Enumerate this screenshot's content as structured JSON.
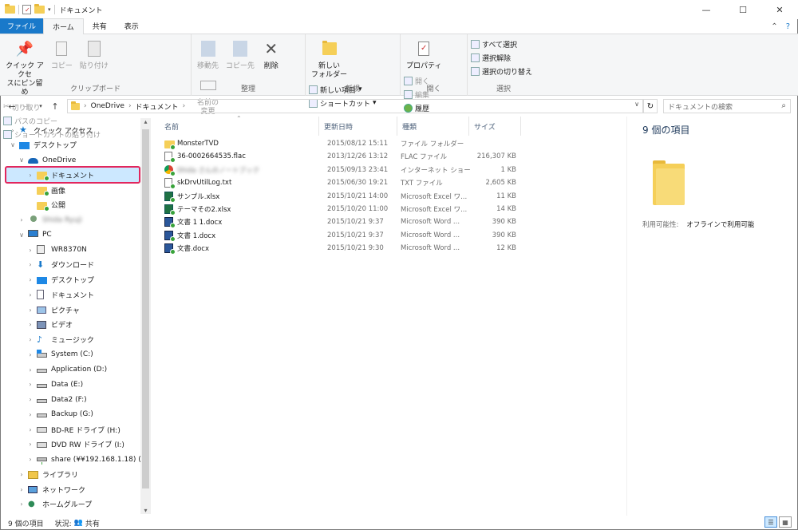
{
  "window": {
    "title": "ドキュメント",
    "controls": [
      "minimize",
      "maximize",
      "close"
    ]
  },
  "ribbon_tabs": [
    "ファイル",
    "ホーム",
    "共有",
    "表示"
  ],
  "ribbon": {
    "clipboard": {
      "label": "クリップボード",
      "pin_line1": "クイック アクセ",
      "pin_line2": "スにピン留め",
      "copy": "コピー",
      "paste": "貼り付け",
      "cut": "切り取り",
      "copy_path": "パスのコピー",
      "paste_shortcut": "ショートカットの貼り付け"
    },
    "organize": {
      "label": "整理",
      "move_to": "移動先",
      "copy_to": "コピー先",
      "delete": "削除",
      "rename_line1": "名前の",
      "rename_line2": "変更"
    },
    "new": {
      "label": "新規",
      "new_folder_line1": "新しい",
      "new_folder_line2": "フォルダー",
      "new_item": "新しい項目",
      "shortcut": "ショートカット"
    },
    "open": {
      "label": "開く",
      "properties": "プロパティ",
      "open": "開く",
      "edit": "編集",
      "history": "履歴"
    },
    "select": {
      "label": "選択",
      "select_all": "すべて選択",
      "select_none": "選択解除",
      "invert": "選択の切り替え"
    }
  },
  "address": {
    "path": [
      "OneDrive",
      "ドキュメント"
    ],
    "search_placeholder": "ドキュメントの検索"
  },
  "nav": [
    {
      "label": "クイック アクセス",
      "icon": "star-icon",
      "indent": 0,
      "expander": "collapsed"
    },
    {
      "label": "デスクトップ",
      "icon": "desktop-icon",
      "indent": 0,
      "expander": "expanded"
    },
    {
      "label": "OneDrive",
      "icon": "cloud-icon",
      "indent": 1,
      "expander": "expanded"
    },
    {
      "label": "ドキュメント",
      "icon": "folder-icon",
      "indent": 2,
      "expander": "collapsed",
      "selected": true
    },
    {
      "label": "画像",
      "icon": "folder-icon",
      "indent": 2,
      "expander": "none"
    },
    {
      "label": "公開",
      "icon": "folder-icon",
      "indent": 2,
      "expander": "none"
    },
    {
      "label": "Shida Ryuji",
      "icon": "user-icon",
      "indent": 1,
      "expander": "collapsed",
      "blurred": true
    },
    {
      "label": "PC",
      "icon": "pc-icon",
      "indent": 1,
      "expander": "expanded"
    },
    {
      "label": "WR8370N",
      "icon": "router-icon",
      "indent": 2,
      "expander": "collapsed"
    },
    {
      "label": "ダウンロード",
      "icon": "download-icon",
      "indent": 2,
      "expander": "collapsed"
    },
    {
      "label": "デスクトップ",
      "icon": "desktop-icon",
      "indent": 2,
      "expander": "collapsed"
    },
    {
      "label": "ドキュメント",
      "icon": "document-icon",
      "indent": 2,
      "expander": "collapsed"
    },
    {
      "label": "ピクチャ",
      "icon": "pictures-icon",
      "indent": 2,
      "expander": "collapsed"
    },
    {
      "label": "ビデオ",
      "icon": "video-icon",
      "indent": 2,
      "expander": "collapsed"
    },
    {
      "label": "ミュージック",
      "icon": "music-icon",
      "indent": 2,
      "expander": "collapsed"
    },
    {
      "label": "System (C:)",
      "icon": "system-drive-icon",
      "indent": 2,
      "expander": "collapsed"
    },
    {
      "label": "Application (D:)",
      "icon": "drive-icon",
      "indent": 2,
      "expander": "collapsed"
    },
    {
      "label": "Data (E:)",
      "icon": "drive-icon",
      "indent": 2,
      "expander": "collapsed"
    },
    {
      "label": "Data2 (F:)",
      "icon": "drive-icon",
      "indent": 2,
      "expander": "collapsed"
    },
    {
      "label": "Backup (G:)",
      "icon": "drive-icon",
      "indent": 2,
      "expander": "collapsed"
    },
    {
      "label": "BD-RE ドライブ (H:)",
      "icon": "optical-drive-icon",
      "indent": 2,
      "expander": "collapsed"
    },
    {
      "label": "DVD RW ドライブ (I:)",
      "icon": "optical-drive-icon",
      "indent": 2,
      "expander": "collapsed"
    },
    {
      "label": "share (¥¥192.168.1.18) (Z:)",
      "icon": "network-drive-icon",
      "indent": 2,
      "expander": "collapsed"
    },
    {
      "label": "ライブラリ",
      "icon": "library-icon",
      "indent": 1,
      "expander": "collapsed"
    },
    {
      "label": "ネットワーク",
      "icon": "network-icon",
      "indent": 1,
      "expander": "collapsed"
    },
    {
      "label": "ホームグループ",
      "icon": "homegroup-icon",
      "indent": 1,
      "expander": "collapsed"
    }
  ],
  "columns": {
    "name": "名前",
    "date": "更新日時",
    "type": "種類",
    "size": "サイズ"
  },
  "files": [
    {
      "name": "MonsterTVD",
      "date": "2015/08/12 15:11",
      "type": "ファイル フォルダー",
      "size": "",
      "icon": "folder-icon"
    },
    {
      "name": "36-0002664535.flac",
      "date": "2013/12/26 13:12",
      "type": "FLAC ファイル",
      "size": "216,307 KB",
      "icon": "audio-file-icon"
    },
    {
      "name": "Shida さんのノートブック",
      "date": "2015/09/13 23:41",
      "type": "インターネット ショート...",
      "size": "1 KB",
      "icon": "chrome-shortcut-icon",
      "blurred": true
    },
    {
      "name": "skDrvUtilLog.txt",
      "date": "2015/06/30 19:21",
      "type": "TXT ファイル",
      "size": "2,605 KB",
      "icon": "text-file-icon"
    },
    {
      "name": "サンプル.xlsx",
      "date": "2015/10/21 14:00",
      "type": "Microsoft Excel ワ...",
      "size": "11 KB",
      "icon": "excel-file-icon"
    },
    {
      "name": "テーマその2.xlsx",
      "date": "2015/10/20 11:00",
      "type": "Microsoft Excel ワ...",
      "size": "14 KB",
      "icon": "excel-file-icon"
    },
    {
      "name": "文書 1 1.docx",
      "date": "2015/10/21 9:37",
      "type": "Microsoft Word ...",
      "size": "390 KB",
      "icon": "word-file-icon"
    },
    {
      "name": "文書 1.docx",
      "date": "2015/10/21 9:37",
      "type": "Microsoft Word ...",
      "size": "390 KB",
      "icon": "word-file-icon"
    },
    {
      "name": "文書.docx",
      "date": "2015/10/21 9:30",
      "type": "Microsoft Word ...",
      "size": "12 KB",
      "icon": "word-file-icon"
    }
  ],
  "details": {
    "count": "9 個の項目",
    "availability_label": "利用可能性:",
    "availability_value": "オフラインで利用可能"
  },
  "status": {
    "count": "9 個の項目",
    "state_label": "状況:",
    "state_value": "共有"
  },
  "colors": {
    "accent": "#1979ca",
    "selection": "#cce8ff",
    "highlight_border": "#e2265d",
    "folder": "#f5cf58",
    "sync_ok": "#39a33b"
  }
}
